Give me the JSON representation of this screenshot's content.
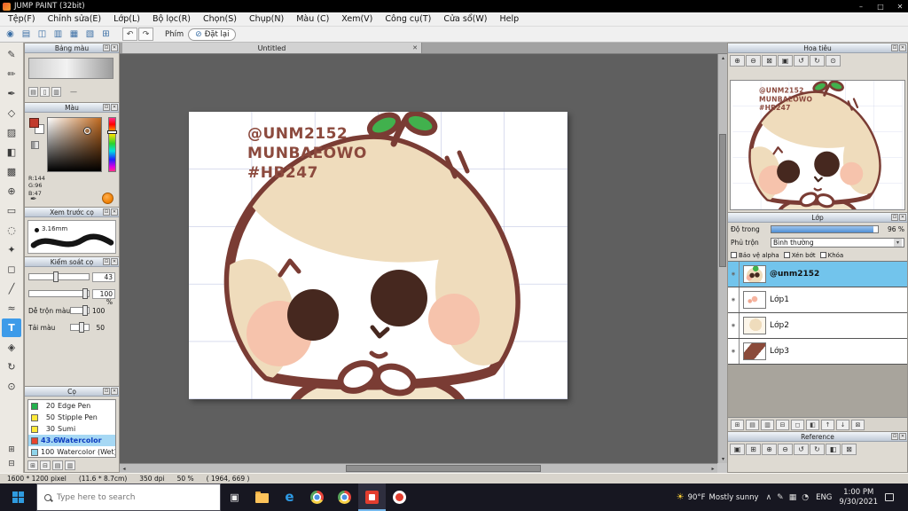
{
  "window": {
    "title": "JUMP PAINT (32bit)"
  },
  "ui": {
    "win_min": "–",
    "win_max": "□",
    "win_close": "✕",
    "panel_max": "⊡",
    "panel_close": "✕",
    "dropdown_arrow": "▾",
    "arrow_up": "▴",
    "arrow_down": "▾",
    "arrow_left": "◂",
    "arrow_right": "▸",
    "taskview_glyph": "▣",
    "eye_glyph": "◉",
    "sun_glyph": "☀",
    "undo_glyph": "↶",
    "redo_glyph": "↷",
    "reset_glyph": "⊘",
    "close_tab_glyph": "✕"
  },
  "menu": {
    "items": [
      "Tệp(F)",
      "Chỉnh sửa(E)",
      "Lớp(L)",
      "Bộ lọc(R)",
      "Chọn(S)",
      "Chụp(N)",
      "Màu (C)",
      "Xem(V)",
      "Công cụ(T)",
      "Cửa sổ(W)",
      "Help"
    ]
  },
  "toolbar": {
    "icons": [
      {
        "name": "new-canvas-button",
        "glyph": "◉"
      },
      {
        "name": "open-file-button",
        "glyph": "▤"
      },
      {
        "name": "save-button",
        "glyph": "◫"
      },
      {
        "name": "export-button",
        "glyph": "▥"
      },
      {
        "name": "copy-button",
        "glyph": "▦"
      },
      {
        "name": "paste-button",
        "glyph": "▧"
      },
      {
        "name": "grid-toggle-button",
        "glyph": "⊞"
      }
    ],
    "phim_label": "Phím",
    "reset_label": "Đặt lại"
  },
  "tool_strip": {
    "tools": [
      {
        "name": "pen-tool",
        "glyph": "✎",
        "selected": false
      },
      {
        "name": "pencil-tool",
        "glyph": "✏",
        "selected": false
      },
      {
        "name": "dip-pen-tool",
        "glyph": "✒",
        "selected": false
      },
      {
        "name": "eraser-tool",
        "glyph": "◇",
        "selected": false
      },
      {
        "name": "airbrush-tool",
        "glyph": "▨",
        "selected": false
      },
      {
        "name": "fill-bucket-tool",
        "glyph": "◧",
        "selected": false
      },
      {
        "name": "gradient-tool",
        "glyph": "▩",
        "selected": false
      },
      {
        "name": "move-tool",
        "glyph": "⊕",
        "selected": false
      },
      {
        "name": "select-rect-tool",
        "glyph": "▭",
        "selected": false
      },
      {
        "name": "lasso-tool",
        "glyph": "◌",
        "selected": false
      },
      {
        "name": "magic-wand-tool",
        "glyph": "✦",
        "selected": false
      },
      {
        "name": "shape-tool",
        "glyph": "◻",
        "selected": false
      },
      {
        "name": "line-tool",
        "glyph": "╱",
        "selected": false
      },
      {
        "name": "curve-tool",
        "glyph": "≈",
        "selected": false
      },
      {
        "name": "text-tool",
        "glyph": "T",
        "selected": true
      },
      {
        "name": "hand-tool",
        "glyph": "◈",
        "selected": false
      },
      {
        "name": "rotate-view-tool",
        "glyph": "↻",
        "selected": false
      },
      {
        "name": "zoom-tool",
        "glyph": "⊙",
        "selected": false
      }
    ],
    "bottom": [
      {
        "name": "panel-dock-left-button",
        "glyph": "⊞"
      },
      {
        "name": "panel-dock-right-button",
        "glyph": "⊟"
      }
    ]
  },
  "left_panels": {
    "palette": {
      "title": "Bảng màu",
      "dash": "—",
      "action_icons": [
        {
          "name": "add-color-button",
          "glyph": "▤"
        },
        {
          "name": "delete-color-button",
          "glyph": "▯"
        },
        {
          "name": "palette-menu-button",
          "glyph": "▥"
        }
      ]
    },
    "color": {
      "title": "Màu",
      "r": "R:144",
      "g": "G:96",
      "b": "B:47",
      "dropper_glyph": "✒"
    },
    "brush_preview": {
      "title": "Xem trước cọ",
      "size_label": "3.16mm"
    },
    "brush_control": {
      "title": "Kiểm soát cọ",
      "size_value": "43",
      "opacity_value": "100 %",
      "mix_label": "Dễ trộn màu",
      "mix_value": "100",
      "load_label": "Tải màu",
      "load_value": "50"
    },
    "brushes": {
      "title": "Cọ",
      "items": [
        {
          "value": "20",
          "name": "Edge Pen",
          "color": "#23b14d",
          "selected": false
        },
        {
          "value": "50",
          "name": "Stipple Pen",
          "color": "#ffe93a",
          "selected": false
        },
        {
          "value": "30",
          "name": "Sumi",
          "color": "#ffe93a",
          "selected": false
        },
        {
          "value": "43.6",
          "name": "Watercolor",
          "color": "#e8452f",
          "selected": true
        },
        {
          "value": "100",
          "name": "Watercolor (Wet)",
          "color": "#8fd4ea",
          "selected": false
        }
      ],
      "action_icons": [
        {
          "name": "add-brush-button",
          "glyph": "⊞"
        },
        {
          "name": "remove-brush-button",
          "glyph": "⊟"
        },
        {
          "name": "duplicate-brush-button",
          "glyph": "▤"
        },
        {
          "name": "brush-settings-button",
          "glyph": "▥"
        }
      ]
    }
  },
  "canvas": {
    "tab_label": "Untitled",
    "artwork": {
      "line1": "@UNM2152",
      "line2": "MUNBAEOWO",
      "line3": "#HB247"
    }
  },
  "navigator": {
    "title": "Hoa tiêu",
    "icons": [
      {
        "name": "nav-zoom-in-button",
        "glyph": "⊕"
      },
      {
        "name": "nav-zoom-out-button",
        "glyph": "⊖"
      },
      {
        "name": "nav-fit-button",
        "glyph": "⊠"
      },
      {
        "name": "nav-actual-size-button",
        "glyph": "▣"
      },
      {
        "name": "nav-rotate-left-button",
        "glyph": "↺"
      },
      {
        "name": "nav-rotate-right-button",
        "glyph": "↻"
      },
      {
        "name": "nav-reset-button",
        "glyph": "⊙"
      }
    ]
  },
  "layers": {
    "title": "Lớp",
    "opacity_label": "Độ trong",
    "opacity_value": "96 %",
    "opacity_percent": 96,
    "blend_label": "Phủ trộn",
    "blend_value": "Bình thường",
    "checkboxes": [
      "Bảo vệ alpha",
      "Xén bớt",
      "Khóa"
    ],
    "items": [
      {
        "name": "@unm2152",
        "selected": true
      },
      {
        "name": "Lớp1",
        "selected": false
      },
      {
        "name": "Lớp2",
        "selected": false
      },
      {
        "name": "Lớp3",
        "selected": false
      }
    ],
    "action_icons": [
      {
        "name": "new-layer-button",
        "glyph": "⊞"
      },
      {
        "name": "new-folder-button",
        "glyph": "▤"
      },
      {
        "name": "duplicate-layer-button",
        "glyph": "▥"
      },
      {
        "name": "merge-layer-button",
        "glyph": "⊟"
      },
      {
        "name": "clear-layer-button",
        "glyph": "◻"
      },
      {
        "name": "layer-mask-button",
        "glyph": "◧"
      },
      {
        "name": "move-layer-up-button",
        "glyph": "↑"
      },
      {
        "name": "move-layer-down-button",
        "glyph": "↓"
      },
      {
        "name": "delete-layer-button",
        "glyph": "⊠"
      }
    ]
  },
  "reference": {
    "title": "Reference",
    "icons": [
      {
        "name": "ref-open-button",
        "glyph": "▣"
      },
      {
        "name": "ref-add-button",
        "glyph": "⊞"
      },
      {
        "name": "ref-zoom-in-button",
        "glyph": "⊕"
      },
      {
        "name": "ref-zoom-out-button",
        "glyph": "⊖"
      },
      {
        "name": "ref-rotate-left-button",
        "glyph": "↺"
      },
      {
        "name": "ref-rotate-right-button",
        "glyph": "↻"
      },
      {
        "name": "ref-flip-button",
        "glyph": "◧"
      },
      {
        "name": "ref-clear-button",
        "glyph": "⊠"
      }
    ]
  },
  "status_bar": {
    "size": "1600 * 1200 pixel",
    "dimensions": "(11.6 * 8.7cm)",
    "dpi": "350 dpi",
    "zoom": "50 %",
    "coords": "( 1964, 669 )"
  },
  "taskbar": {
    "search_placeholder": "Type here to search",
    "apps": [
      {
        "name": "task-view-button",
        "icon": "taskview",
        "active": false
      },
      {
        "name": "file-explorer-app",
        "icon": "folder",
        "active": false
      },
      {
        "name": "edge-browser-app",
        "icon": "edge",
        "glyph": "e",
        "active": false
      },
      {
        "name": "chrome-browser-app",
        "icon": "chrome",
        "active": false
      },
      {
        "name": "chrome-browser-app-2",
        "icon": "chrome",
        "active": false
      },
      {
        "name": "jump-paint-app",
        "icon": "jump",
        "active": true
      },
      {
        "name": "medibang-paint-app",
        "icon": "medibang",
        "active": false
      }
    ],
    "weather_temp": "90°F",
    "weather_desc": "Mostly sunny",
    "tray_icons": [
      {
        "name": "hidden-icons-button",
        "glyph": "∧"
      },
      {
        "name": "pen-settings-tray-icon",
        "glyph": "✎"
      },
      {
        "name": "keyboard-tray-icon",
        "glyph": "▦"
      },
      {
        "name": "network-tray-icon",
        "glyph": "◔"
      }
    ],
    "language": "ENG",
    "time": "1:00 PM",
    "date": "9/30/2021"
  },
  "colors": {
    "accent_blue": "#3d9be9",
    "selected_layer": "#72c4ec",
    "selected_brush_row": "#a6d8f4",
    "canvas_bg": "#5f5f5f",
    "outline_brown": "#7a3c34",
    "skin_tan": "#efdcbc",
    "blush_pink": "#f6c3ac",
    "leaf_green": "#41b14d",
    "taskbar_bg": "#171721"
  }
}
